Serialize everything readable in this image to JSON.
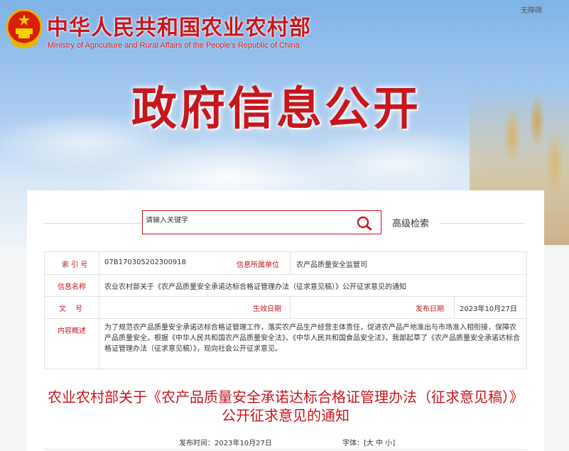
{
  "header": {
    "site_title": "中华人民共和国农业农村部",
    "site_subtitle": "Ministry of Agriculture and Rural Affairs of the People's Republic of China",
    "accessibility_link": "无障碍",
    "hero_title": "政府信息公开"
  },
  "search": {
    "placeholder": "请输入关键字",
    "advanced_label": "高级检索"
  },
  "meta": {
    "index_label": "索 引 号",
    "index_value": "07B170305202300918",
    "unit_label": "信息所属单位",
    "unit_value": "农产品质量安全监管司",
    "name_label": "信息名称",
    "name_value": "农业农村部关于《农产品质量安全承诺达标合格证管理办法（征求意见稿）》公开征求意见的通知",
    "docno_label": "文　 号",
    "docno_value": "",
    "effective_label": "生效日期",
    "effective_value": "",
    "release_label": "发布日期",
    "release_value": "2023年10月27日",
    "summary_label": "内容概述",
    "summary_value": "为了规范农产品质量安全承诺达标合格证管理工作，落实农产品生产经营主体责任，促进农产品产地准出与市场准入相衔接，保障农产品质量安全，根据《中华人民共和国农产品质量安全法》、《中华人民共和国食品安全法》，我部起草了《农产品质量安全承诺达标合格证管理办法（征求意见稿）》，现向社会公开征求意见。"
  },
  "article": {
    "title": "农业农村部关于《农产品质量安全承诺达标合格证管理办法（征求意见稿）》公开征求意见的通知",
    "publish_label": "发布时间：",
    "publish_date": "2023年10月27日",
    "font_label": "字体：",
    "font_options": [
      "[大",
      "中",
      "小]"
    ]
  },
  "colors": {
    "brand_red": "#c8161d",
    "border": "#e3e3e3"
  }
}
